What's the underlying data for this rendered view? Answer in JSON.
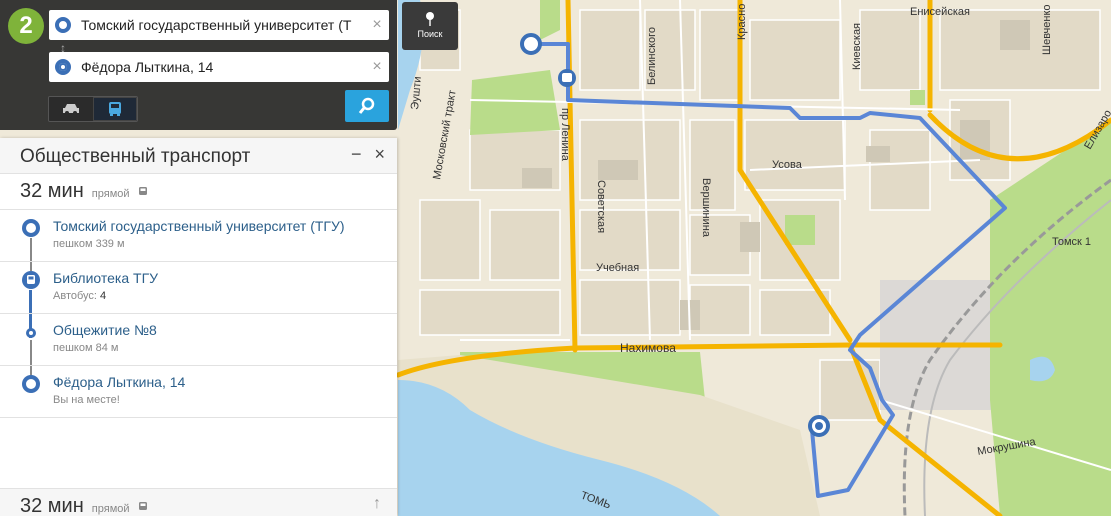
{
  "app": {
    "logo_text": "2"
  },
  "search": {
    "from_value": "Томский государственный университет (Т",
    "to_value": "Фёдора Лыткина, 14",
    "search_tab_label": "Поиск",
    "clear_glyph": "×"
  },
  "route_panel": {
    "title": "Общественный транспорт",
    "minimize_glyph": "−",
    "close_glyph": "×",
    "duration": "32 мин",
    "kind": "прямой",
    "steps": [
      {
        "name": "Томский государственный университет (ТГУ)",
        "sub": "пешком 339 м"
      },
      {
        "name": "Библиотека ТГУ",
        "sub_prefix": "Автобус: ",
        "sub_value": "4"
      },
      {
        "name": "Общежитие №8",
        "sub": "пешком 84 м"
      },
      {
        "name": "Фёдора Лыткина, 14",
        "sub": "Вы на месте!"
      }
    ],
    "footer_duration": "32 мин",
    "footer_kind": "прямой"
  },
  "map": {
    "labels": {
      "eniseyskaya": "Енисейская",
      "shevchenko": "Шевченко",
      "elizarovykh": "Елизаро",
      "krasnoarmeyskaya": "Красно",
      "kievskaya": "Киевская",
      "belinskogo": "Белинского",
      "sovetskaya": "Советская",
      "lenina": "пр Ленина",
      "moskovsky": "Московский тракт",
      "euntina": "Эушти",
      "usova": "Усова",
      "vershinina": "Вершинина",
      "uchebnaya": "Учебная",
      "nakhimova": "Нахимова",
      "tom1": "Томск 1",
      "mokrushina": "Мокрушина",
      "tom_river": "ТОМЬ"
    },
    "colors": {
      "land": "#efe9d9",
      "block": "#e3dccb",
      "park": "#b9dc8a",
      "water": "#a7d3ee",
      "road_major": "#f5b400",
      "route": "#5a86d6"
    }
  }
}
